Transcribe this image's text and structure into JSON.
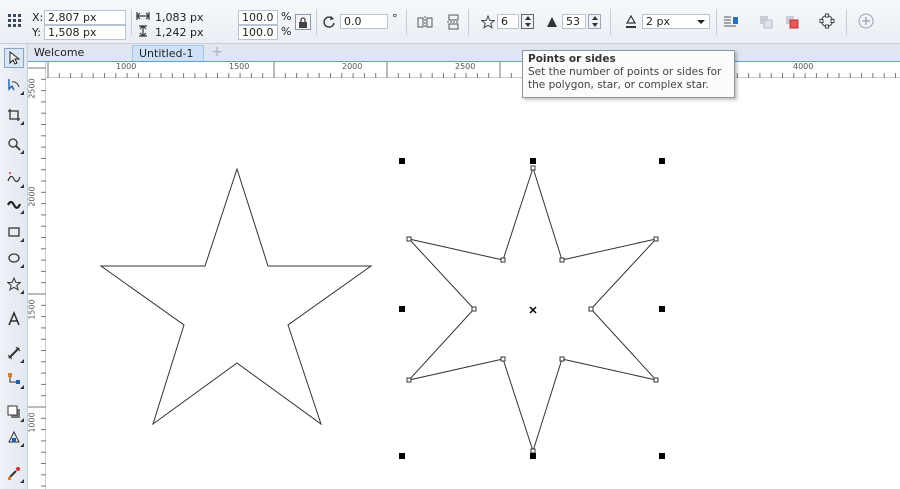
{
  "property_bar": {
    "x_label": "X:",
    "x_value": "2,807 px",
    "y_label": "Y:",
    "y_value": "1,508 px",
    "width_value": "1,083 px",
    "height_value": "1,242 px",
    "scale_x": "100.0",
    "scale_y": "100.0",
    "percent_x": "%",
    "percent_y": "%",
    "rotation_value": "0.0",
    "degree_symbol": "°",
    "points_value": "6",
    "sharpness_value": "53",
    "outline_width": "2 px"
  },
  "tabs": {
    "welcome": "Welcome Screen",
    "document": "Untitled-1",
    "add": "+"
  },
  "rulers": {
    "h_labels": [
      "1000",
      "1500",
      "2000",
      "2500",
      "4000"
    ],
    "v_labels": [
      "2500",
      "2000",
      "1500",
      "1000"
    ]
  },
  "tooltip": {
    "title": "Points or sides",
    "body": "Set the number of points or sides for the polygon, star, or complex star."
  },
  "colors": {
    "selection_handle": "#000000",
    "shape_outline": "#333333",
    "tab_active": "#cfe1f6"
  }
}
